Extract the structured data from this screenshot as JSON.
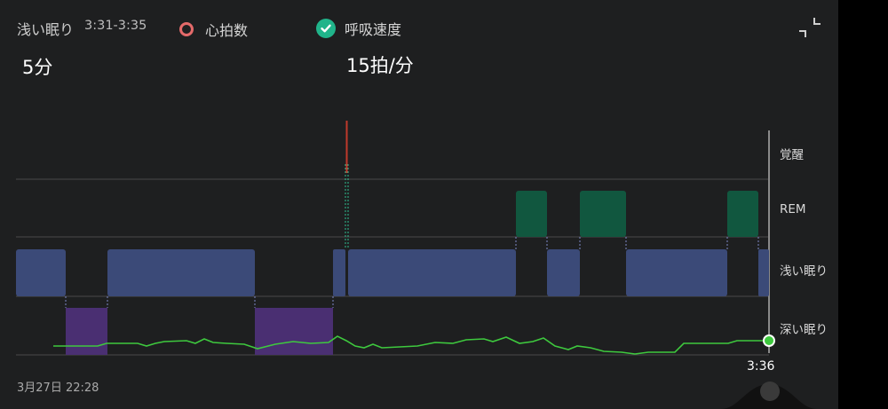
{
  "header": {
    "stage_label": "浅い眠り",
    "time_range": "3:31-3:35",
    "duration": "5分",
    "heart_rate_label": "心拍数",
    "respiration_label": "呼吸速度",
    "respiration_value": "15拍/分"
  },
  "chart": {
    "stage_labels": {
      "awake": "覚醒",
      "rem": "REM",
      "light": "浅い眠り",
      "deep": "深い眠り"
    },
    "start_label": "3月27日 22:28",
    "end_label": "3:36",
    "colors": {
      "light": "#3b4a78",
      "deep": "#4a2f72",
      "rem": "#11573f",
      "awake_marker": "#c0392b",
      "respiration_line": "#3ec93e"
    }
  },
  "chart_data": {
    "type": "hypnogram",
    "x_start": "22:28",
    "x_end": "3:36",
    "stages_order": [
      "深い眠り",
      "浅い眠り",
      "REM",
      "覚醒"
    ],
    "segments": [
      {
        "stage": "浅い眠り",
        "start": "22:28",
        "end": "22:49"
      },
      {
        "stage": "深い眠り",
        "start": "22:49",
        "end": "23:07"
      },
      {
        "stage": "浅い眠り",
        "start": "23:07",
        "end": "0:01"
      },
      {
        "stage": "深い眠り",
        "start": "0:01",
        "end": "0:36"
      },
      {
        "stage": "浅い眠り",
        "start": "0:36",
        "end": "0:41"
      },
      {
        "stage": "覚醒",
        "start": "0:41",
        "end": "0:42"
      },
      {
        "stage": "浅い眠り",
        "start": "0:42",
        "end": "1:57"
      },
      {
        "stage": "REM",
        "start": "1:57",
        "end": "2:11"
      },
      {
        "stage": "浅い眠り",
        "start": "2:11",
        "end": "2:25"
      },
      {
        "stage": "REM",
        "start": "2:25",
        "end": "2:45"
      },
      {
        "stage": "浅い眠り",
        "start": "2:45",
        "end": "3:29"
      },
      {
        "stage": "REM",
        "start": "3:29",
        "end": "3:42"
      },
      {
        "stage": "浅い眠り",
        "start": "3:31",
        "end": "3:35"
      }
    ],
    "respiration_series": "line",
    "selected_point": "3:36"
  }
}
